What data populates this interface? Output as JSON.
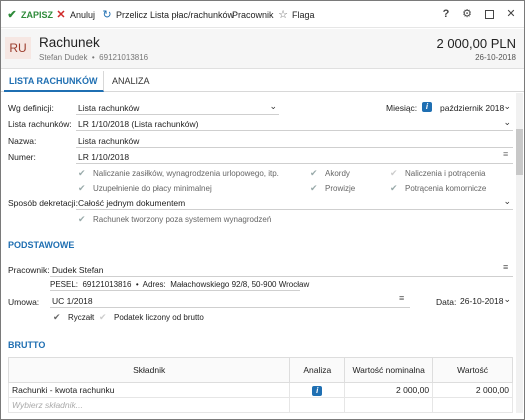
{
  "toolbar": {
    "save": "ZAPISZ",
    "cancel": "Anuluj",
    "recalc": "Przelicz",
    "payroll_lists": "Lista płac/rachunków",
    "employee": "Pracownik",
    "flag": "Flaga"
  },
  "header": {
    "avatar": "RU",
    "title": "Rachunek",
    "subtitle": "Stefan Dudek  •  69121013816",
    "amount": "2 000,00 PLN",
    "date": "26-10-2018"
  },
  "tabs": [
    "LISTA RACHUNKÓW",
    "ANALIZA"
  ],
  "form": {
    "wg_definicji_label": "Wg definicji:",
    "wg_definicji_value": "Lista rachunków",
    "miesiac_label": "Miesiąc:",
    "miesiac_value": "październik 2018",
    "lista_label": "Lista rachunków:",
    "lista_value": "LR 1/10/2018 (Lista rachunków)",
    "nazwa_label": "Nazwa:",
    "nazwa_value": "Lista rachunków",
    "numer_label": "Numer:",
    "numer_value": "LR 1/10/2018",
    "checks": {
      "c1": "Naliczanie zasiłków, wynagrodzenia urlopowego, itp.",
      "c2": "Akordy",
      "c3": "Naliczenia i potrącenia",
      "c4": "Uzupełnienie do płacy minimalnej",
      "c5": "Prowizje",
      "c6": "Potrącenia komornicze"
    },
    "dekretacja_label": "Sposób dekretacji:",
    "dekretacja_value": "Całość jednym dokumentem",
    "poza_systemem": "Rachunek tworzony poza systemem wynagrodzeń"
  },
  "podstawowe": {
    "title": "PODSTAWOWE",
    "pracownik_label": "Pracownik:",
    "pracownik_value": "Dudek Stefan",
    "pesel_line": "PESEL:  69121013816  •  Adres:  Małachowskiego 92/8, 50-900 Wrocław",
    "umowa_label": "Umowa:",
    "umowa_value": "UC 1/2018",
    "data_label": "Data:",
    "data_value": "26-10-2018",
    "ryczalt": "Ryczałt",
    "podatek": "Podatek liczony od brutto"
  },
  "brutto": {
    "title": "BRUTTO",
    "columns": [
      "Składnik",
      "Analiza",
      "Wartość nominalna",
      "Wartość"
    ],
    "rows": [
      {
        "skladnik": "Rachunki - kwota rachunku",
        "nominalna": "2 000,00",
        "wartosc": "2 000,00"
      }
    ],
    "placeholder": "Wybierz składnik..."
  },
  "colors": {
    "accent": "#1f6fb2",
    "save_green": "#2e8b3a",
    "cancel_red": "#d02a2a"
  }
}
